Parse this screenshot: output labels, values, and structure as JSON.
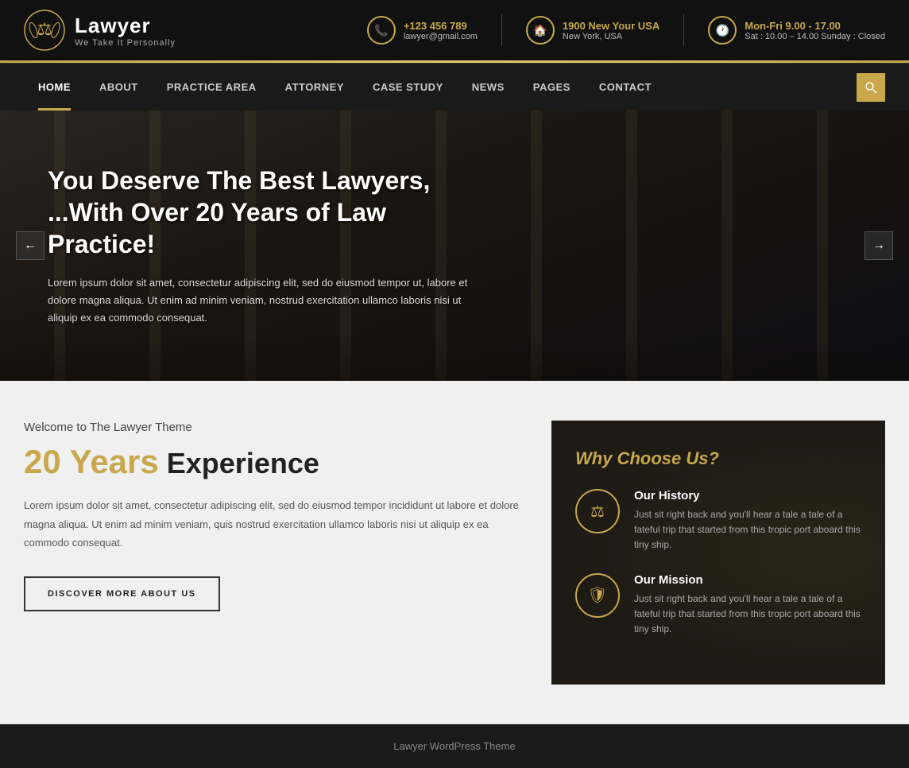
{
  "site": {
    "name": "Lawyer",
    "tagline": "We Take It Personally"
  },
  "header": {
    "phone": "+123 456 789",
    "email": "lawyer@gmail.com",
    "address_line1": "1900 New Your USA",
    "address_line2": "New York, USA",
    "hours_line1": "Mon-Fri 9.00 - 17.00",
    "hours_line2": "Sat : 10.00 – 14.00 Sunday : Closed"
  },
  "nav": {
    "items": [
      {
        "label": "HOME",
        "active": true
      },
      {
        "label": "ABOUT",
        "active": false
      },
      {
        "label": "PRACTICE AREA",
        "active": false
      },
      {
        "label": "ATTORNEY",
        "active": false
      },
      {
        "label": "CASE STUDY",
        "active": false
      },
      {
        "label": "NEWS",
        "active": false
      },
      {
        "label": "PAGES",
        "active": false
      },
      {
        "label": "CONTACT",
        "active": false
      }
    ],
    "search_label": "🔍"
  },
  "hero": {
    "heading_line1": "You Deserve The Best Lawyers,",
    "heading_line2": "...With Over 20 Years of Law Practice!",
    "body": "Lorem ipsum dolor sit amet, consectetur adipiscing elit, sed do eiusmod tempor ut, labore et dolore magna aliqua. Ut enim ad minim veniam, nostrud exercitation ullamco laboris nisi ut aliquip ex ea commodo consequat.",
    "arrow_left": "←",
    "arrow_right": "→"
  },
  "welcome": {
    "label": "Welcome to The Lawyer Theme",
    "years_num": "20 Years",
    "experience": "Experience",
    "body": "Lorem ipsum dolor sit amet, consectetur adipiscing elit, sed do eiusmod tempor incididunt ut labore et dolore magna aliqua. Ut enim ad minim veniam, quis nostrud exercitation ullamco laboris nisi ut aliquip ex ea commodo consequat.",
    "button": "DISCOVER MORE ABOUT US"
  },
  "why": {
    "heading": "Why Choose Us?",
    "items": [
      {
        "title": "Our History",
        "body": "Just sit right back and you'll hear a tale a tale of a fateful trip that started from this tropic port aboard this tiny ship.",
        "icon": "⚖"
      },
      {
        "title": "Our Mission",
        "body": "Just sit right back and you'll hear a tale a tale of a fateful trip that started from this tropic port aboard this tiny ship.",
        "icon": "🛡"
      }
    ]
  },
  "footer": {
    "text": "Lawyer WordPress Theme"
  }
}
